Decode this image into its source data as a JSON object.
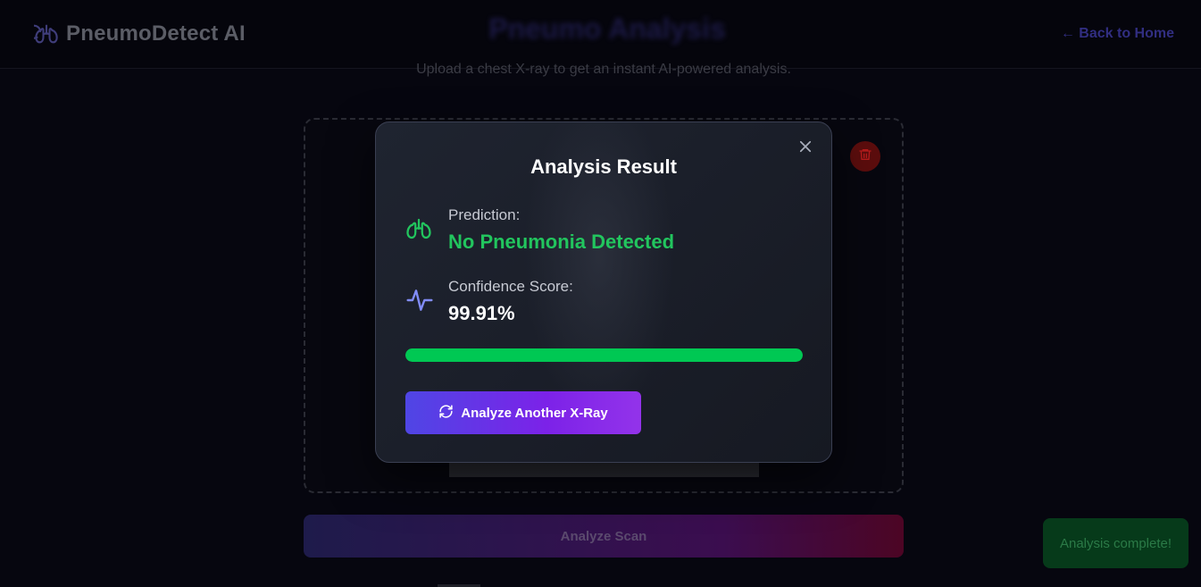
{
  "header": {
    "brand_name": "PneumoDetect AI",
    "page_heading": "Pneumo Analysis",
    "back_link": "← Back to Home"
  },
  "upload": {
    "subtitle": "Upload a chest X-ray to get an instant AI-powered analysis.",
    "analyze_button": "Analyze Scan"
  },
  "modal": {
    "title": "Analysis Result",
    "prediction_label": "Prediction:",
    "prediction_value": "No Pneumonia Detected",
    "confidence_label": "Confidence Score:",
    "confidence_value": "99.91%",
    "confidence_fraction": 0.9991,
    "again_button": "Analyze Another X-Ray"
  },
  "toast": {
    "message": "Analysis complete!"
  },
  "icons": {
    "brand": "lungs-icon",
    "prediction": "lungs-icon",
    "confidence": "activity-pulse-icon",
    "delete": "trash-icon",
    "close": "close-icon",
    "again": "refresh-icon"
  },
  "colors": {
    "success": "#22c55e",
    "progress": "#00c853",
    "accent_start": "#4f46e5",
    "accent_end": "#9333ea",
    "confidence_icon": "#818cf8"
  }
}
